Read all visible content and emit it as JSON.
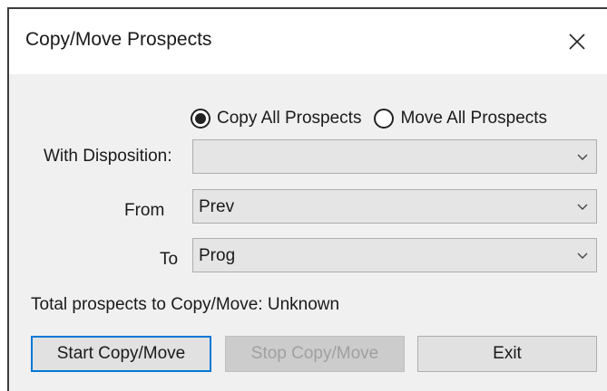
{
  "dialog": {
    "title": "Copy/Move Prospects"
  },
  "mode": {
    "copy_label": "Copy All Prospects",
    "move_label": "Move All Prospects",
    "selected": "copy"
  },
  "fields": {
    "disposition_label": "With Disposition:",
    "disposition_value": "",
    "from_label": "From",
    "from_value": "Prev",
    "to_label": "To",
    "to_value": "Prog"
  },
  "status": {
    "total_text": "Total prospects to Copy/Move: Unknown"
  },
  "buttons": {
    "start_label": "Start Copy/Move",
    "stop_label": "Stop Copy/Move",
    "exit_label": "Exit"
  },
  "icons": {
    "close": "close-icon",
    "dropdown": "chevron-down-icon"
  },
  "colors": {
    "focus_border": "#0078d7",
    "dialog_bg": "#f0f0f0",
    "disabled_text": "#a0a0a0"
  }
}
